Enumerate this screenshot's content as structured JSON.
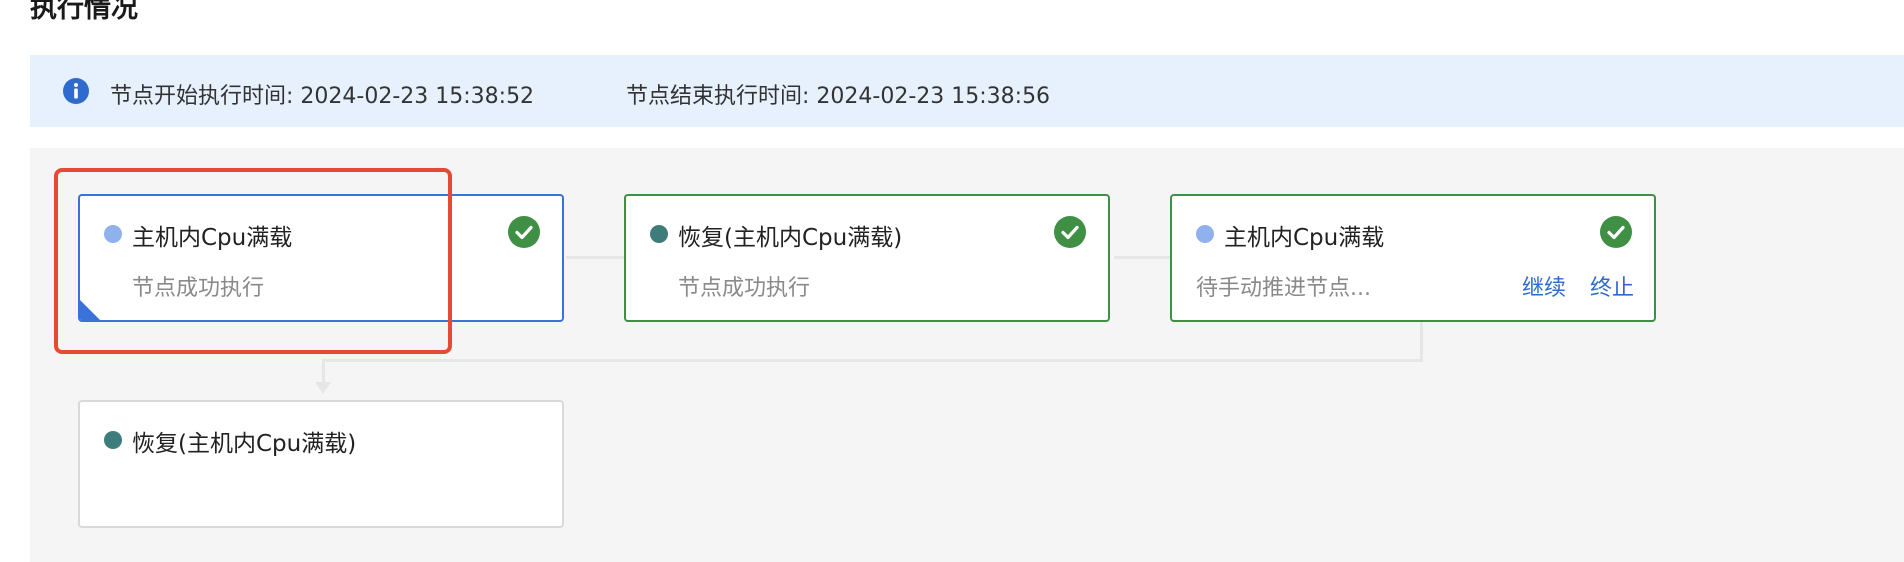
{
  "section_title": "执行情况",
  "info_bar": {
    "icon": "info-icon",
    "start_time": "节点开始执行时间: 2024-02-23 15:38:52",
    "end_time": "节点结束执行时间: 2024-02-23 15:38:56"
  },
  "nodes": [
    {
      "title": "主机内Cpu满载",
      "status": "节点成功执行",
      "dot_color": "#8fb2ee",
      "state_icon": "check-circle-icon",
      "selected": true
    },
    {
      "title": "恢复(主机内Cpu满载)",
      "status": "节点成功执行",
      "dot_color": "#3e7c7c",
      "state_icon": "check-circle-icon"
    },
    {
      "title": "主机内Cpu满载",
      "status": "待手动推进节点...",
      "dot_color": "#8fb2ee",
      "state_icon": "check-circle-icon",
      "actions": {
        "continue": "继续",
        "stop": "终止"
      }
    },
    {
      "title": "恢复(主机内Cpu满载)",
      "status": "",
      "dot_color": "#3e7c7c"
    }
  ],
  "colors": {
    "success_border": "#3f8f44",
    "selected_border": "#3b72d9",
    "highlight": "#e54a33",
    "link": "#2f6bcf",
    "info_bg": "#e7f1fd"
  }
}
